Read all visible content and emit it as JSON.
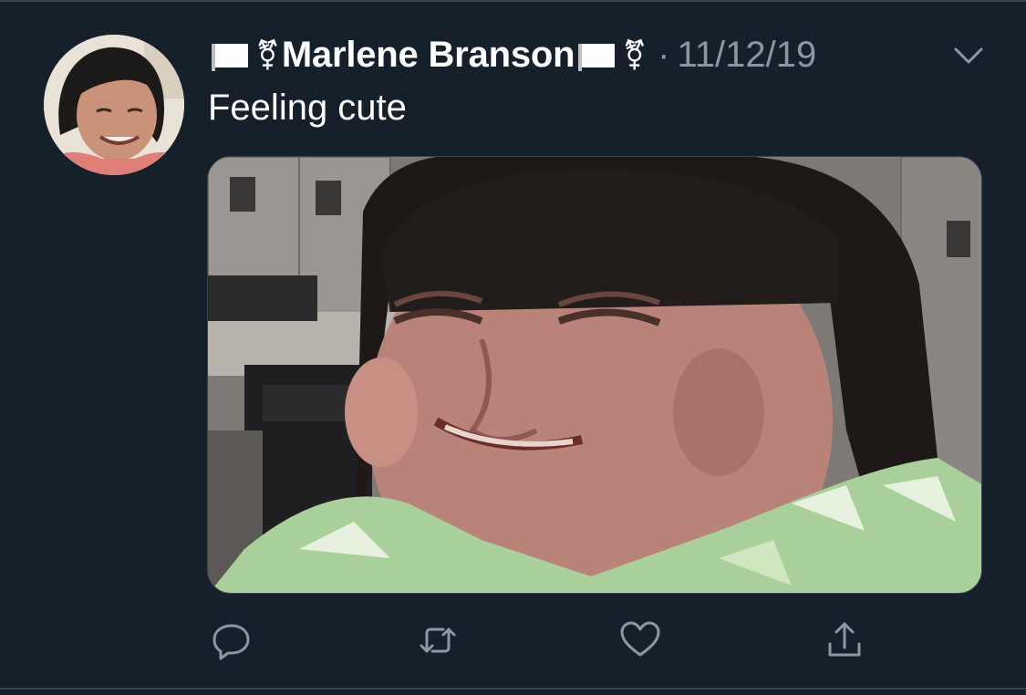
{
  "tweet": {
    "display_name": "Marlene Branson",
    "separator": "·",
    "timestamp": "11/12/19",
    "text": "Feeling cute",
    "name_prefix_flag_icon": "white-flag-icon",
    "name_prefix_symbol": "⚧",
    "name_suffix_flag_icon": "white-flag-icon",
    "name_suffix_symbol": "⚧"
  },
  "icons": {
    "menu": "chevron-down-icon",
    "reply": "reply-icon",
    "retweet": "retweet-icon",
    "like": "heart-icon",
    "share": "share-icon"
  },
  "colors": {
    "background": "#15202b",
    "secondary_text": "#8899a6",
    "divider": "#38444d",
    "primary_text": "#ffffff"
  }
}
